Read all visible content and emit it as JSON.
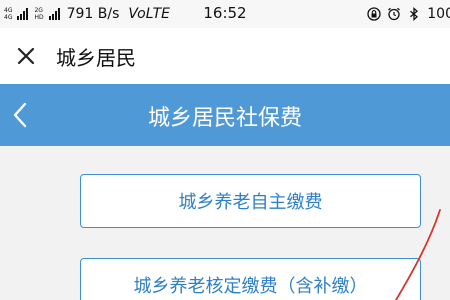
{
  "status_bar": {
    "network_small_top": "4G",
    "network_small_bottom": "4G",
    "network_small_top_2": "2G",
    "network_small_bottom_2": "HD",
    "net_speed": "791 B/s",
    "volte": "VoLTE",
    "time": "16:52",
    "battery": "100"
  },
  "title_bar": {
    "title": "城乡居民",
    "close_icon": "close-icon"
  },
  "header": {
    "title": "城乡居民社保费",
    "back_icon": "chevron-left-icon",
    "color": "#4f9ad6"
  },
  "options": [
    {
      "label": "城乡养老自主缴费"
    },
    {
      "label": "城乡养老核定缴费（含补缴）"
    }
  ],
  "colors": {
    "accent": "#3f8fd2",
    "annotation": "#d9342b"
  }
}
